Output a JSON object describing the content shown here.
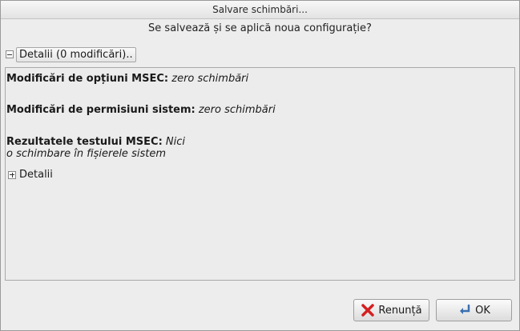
{
  "window": {
    "title": "Salvare schimbări..."
  },
  "dialog": {
    "question": "Se salvează și se aplică noua configurație?"
  },
  "details_expander": {
    "label": "Detalii (0 modificări).."
  },
  "details": {
    "msec_options_label": "Modificări de opțiuni MSEC:",
    "msec_options_value": "zero schimbări",
    "system_permissions_label": "Modificări de permisiuni sistem:",
    "system_permissions_value": "zero schimbări",
    "test_results_label": "Rezultatele testului MSEC:",
    "test_results_value_1": "Nici",
    "test_results_value_2": "o schimbare în fișierele sistem",
    "inner_expander_label": "Detalii"
  },
  "buttons": {
    "cancel": "Renunță",
    "ok": "OK"
  },
  "icons": {
    "cancel": "red-x-icon",
    "ok": "enter-arrow-icon"
  },
  "colors": {
    "cancel_icon": "#d42020",
    "ok_icon": "#3a6fb0"
  }
}
